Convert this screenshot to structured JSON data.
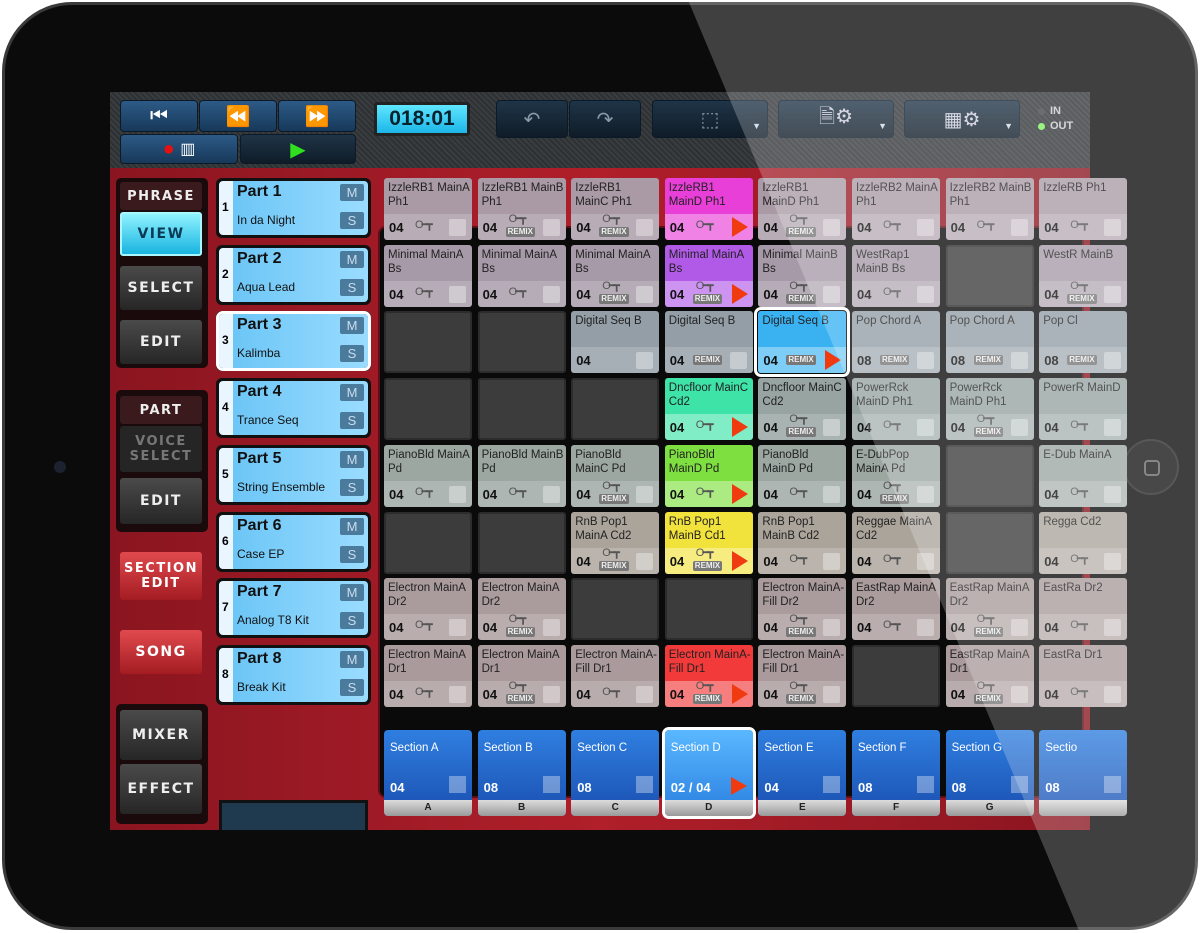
{
  "toolbar": {
    "time": "018:01",
    "icons": {
      "skip_back": "skip-to-start-icon",
      "rewind": "rewind-icon",
      "ffwd": "fast-forward-icon",
      "record": "record-icon",
      "keyboard": "piano-keyboard-icon",
      "play": "play-icon",
      "undo": "undo-icon",
      "redo": "redo-icon",
      "select": "selection-rect-icon",
      "file": "file-settings-icon",
      "grid": "grid-settings-icon"
    },
    "in_label": "IN",
    "out_label": "OUT"
  },
  "left": {
    "phrase": "PHRASE",
    "view": "VIEW",
    "select": "SELECT",
    "edit": "EDIT",
    "part": "PART",
    "voice_select": "VOICE SELECT",
    "part_edit": "EDIT",
    "section_edit": "SECTION EDIT",
    "song": "SONG",
    "mixer": "MIXER",
    "effect": "EFFECT"
  },
  "parts": [
    {
      "num": "1",
      "title": "Part 1",
      "voice": "In da Night"
    },
    {
      "num": "2",
      "title": "Part 2",
      "voice": "Aqua Lead"
    },
    {
      "num": "3",
      "title": "Part 3",
      "voice": "Kalimba",
      "selected": true
    },
    {
      "num": "4",
      "title": "Part 4",
      "voice": "Trance Seq"
    },
    {
      "num": "5",
      "title": "Part 5",
      "voice": "String Ensemble"
    },
    {
      "num": "6",
      "title": "Part 6",
      "voice": "Case EP"
    },
    {
      "num": "7",
      "title": "Part 7",
      "voice": "Analog T8 Kit"
    },
    {
      "num": "8",
      "title": "Part 8",
      "voice": "Break Kit"
    }
  ],
  "part_buttons": {
    "mute": "M",
    "solo": "S"
  },
  "key": "C",
  "remix_label": "REMIX",
  "colors": {
    "magenta": "#e83fd8",
    "violet": "#b25ae8",
    "blue": "#3ab2f2",
    "teal": "#3ee3a8",
    "green": "#7ee040",
    "yellow": "#f2e23c",
    "red": "#f23a3a"
  },
  "grid": [
    [
      {
        "n": "IzzleRB1 MainA Ph1",
        "l": "04",
        "k": 1
      },
      {
        "n": "IzzleRB1 MainB Ph1",
        "l": "04",
        "k": 1,
        "r": 1
      },
      {
        "n": "IzzleRB1 MainC Ph1",
        "l": "04",
        "k": 1,
        "r": 1
      },
      {
        "n": "IzzleRB1 MainD Ph1",
        "l": "04",
        "k": 1,
        "p": 1,
        "c": "magenta"
      },
      {
        "n": "IzzleRB1 MainD Ph1",
        "l": "04",
        "k": 1,
        "r": 1
      },
      {
        "n": "IzzleRB2 MainA Ph1",
        "l": "04",
        "k": 1
      },
      {
        "n": "IzzleRB2 MainB Ph1",
        "l": "04",
        "k": 1
      },
      {
        "n": "IzzleRB Ph1",
        "l": "04",
        "k": 1
      }
    ],
    [
      {
        "n": "Minimal MainA Bs",
        "l": "04",
        "k": 1
      },
      {
        "n": "Minimal MainA Bs",
        "l": "04",
        "k": 1
      },
      {
        "n": "Minimal MainA Bs",
        "l": "04",
        "k": 1,
        "r": 1
      },
      {
        "n": "Minimal MainA Bs",
        "l": "04",
        "k": 1,
        "r": 1,
        "p": 1,
        "c": "violet"
      },
      {
        "n": "Minimal MainB Bs",
        "l": "04",
        "k": 1,
        "r": 1
      },
      {
        "n": "WestRap1 MainB Bs",
        "l": "04",
        "k": 1
      },
      null,
      {
        "n": "WestR MainB",
        "l": "04",
        "k": 1,
        "r": 1
      }
    ],
    [
      null,
      null,
      {
        "n": "Digital Seq B",
        "l": "04"
      },
      {
        "n": "Digital Seq B",
        "l": "04",
        "r": 1
      },
      {
        "n": "Digital Seq B",
        "l": "04",
        "r": 1,
        "p": 1,
        "c": "blue",
        "sel": 1
      },
      {
        "n": "Pop Chord A",
        "l": "08",
        "r": 1
      },
      {
        "n": "Pop Chord A",
        "l": "08",
        "r": 1
      },
      {
        "n": "Pop Cl",
        "l": "08",
        "r": 1
      }
    ],
    [
      null,
      null,
      null,
      {
        "n": "Dncfloor MainC Cd2",
        "l": "04",
        "k": 1,
        "p": 1,
        "c": "teal"
      },
      {
        "n": "Dncfloor MainC Cd2",
        "l": "04",
        "k": 1,
        "r": 1
      },
      {
        "n": "PowerRck MainD Ph1",
        "l": "04",
        "k": 1
      },
      {
        "n": "PowerRck MainD Ph1",
        "l": "04",
        "k": 1,
        "r": 1
      },
      {
        "n": "PowerR MainD",
        "l": "04",
        "k": 1
      }
    ],
    [
      {
        "n": "PianoBld MainA Pd",
        "l": "04",
        "k": 1
      },
      {
        "n": "PianoBld MainB Pd",
        "l": "04",
        "k": 1
      },
      {
        "n": "PianoBld MainC Pd",
        "l": "04",
        "k": 1,
        "r": 1
      },
      {
        "n": "PianoBld MainD Pd",
        "l": "04",
        "k": 1,
        "p": 1,
        "c": "green"
      },
      {
        "n": "PianoBld MainD Pd",
        "l": "04",
        "k": 1
      },
      {
        "n": "E-DubPop MainA Pd",
        "l": "04",
        "k": 1,
        "r": 1
      },
      null,
      {
        "n": "E-Dub MainA",
        "l": "04",
        "k": 1
      }
    ],
    [
      null,
      null,
      {
        "n": "RnB Pop1 MainA Cd2",
        "l": "04",
        "k": 1,
        "r": 1
      },
      {
        "n": "RnB Pop1 MainB Cd1",
        "l": "04",
        "k": 1,
        "r": 1,
        "p": 1,
        "c": "yellow"
      },
      {
        "n": "RnB Pop1 MainB Cd2",
        "l": "04",
        "k": 1
      },
      {
        "n": "Reggae MainA Cd2",
        "l": "04",
        "k": 1
      },
      null,
      {
        "n": "Regga Cd2",
        "l": "04",
        "k": 1
      }
    ],
    [
      {
        "n": "Electron MainA Dr2",
        "l": "04",
        "k": 1
      },
      {
        "n": "Electron MainA Dr2",
        "l": "04",
        "k": 1,
        "r": 1
      },
      null,
      null,
      {
        "n": "Electron MainA-Fill Dr2",
        "l": "04",
        "k": 1,
        "r": 1
      },
      {
        "n": "EastRap MainA Dr2",
        "l": "04",
        "k": 1
      },
      {
        "n": "EastRap MainA Dr2",
        "l": "04",
        "k": 1,
        "r": 1
      },
      {
        "n": "EastRa Dr2",
        "l": "04",
        "k": 1
      }
    ],
    [
      {
        "n": "Electron MainA Dr1",
        "l": "04",
        "k": 1
      },
      {
        "n": "Electron MainA Dr1",
        "l": "04",
        "k": 1,
        "r": 1
      },
      {
        "n": "Electron MainA-Fill Dr1",
        "l": "04",
        "k": 1
      },
      {
        "n": "Electron MainA-Fill Dr1",
        "l": "04",
        "k": 1,
        "r": 1,
        "p": 1,
        "c": "red"
      },
      {
        "n": "Electron MainA-Fill Dr1",
        "l": "04",
        "k": 1,
        "r": 1
      },
      null,
      {
        "n": "EastRap MainA Dr1",
        "l": "04",
        "k": 1,
        "r": 1
      },
      {
        "n": "EastRa Dr1",
        "l": "04",
        "k": 1
      }
    ]
  ],
  "row_tints": [
    "#a99aa6",
    "#a79aa8",
    "#939ea6",
    "#97a4a2",
    "#9ca7a2",
    "#aba49b",
    "#aa9b9c",
    "#aa9a9b"
  ],
  "sections": [
    {
      "n": "Section A",
      "l": "04",
      "letter": "A"
    },
    {
      "n": "Section B",
      "l": "08",
      "letter": "B"
    },
    {
      "n": "Section C",
      "l": "08",
      "letter": "C"
    },
    {
      "n": "Section D",
      "l": "02 / 04",
      "letter": "D",
      "p": 1,
      "sel": 1
    },
    {
      "n": "Section E",
      "l": "04",
      "letter": "E"
    },
    {
      "n": "Section F",
      "l": "08",
      "letter": "F"
    },
    {
      "n": "Section G",
      "l": "08",
      "letter": "G"
    },
    {
      "n": "Sectio",
      "l": "08",
      "letter": ""
    }
  ]
}
